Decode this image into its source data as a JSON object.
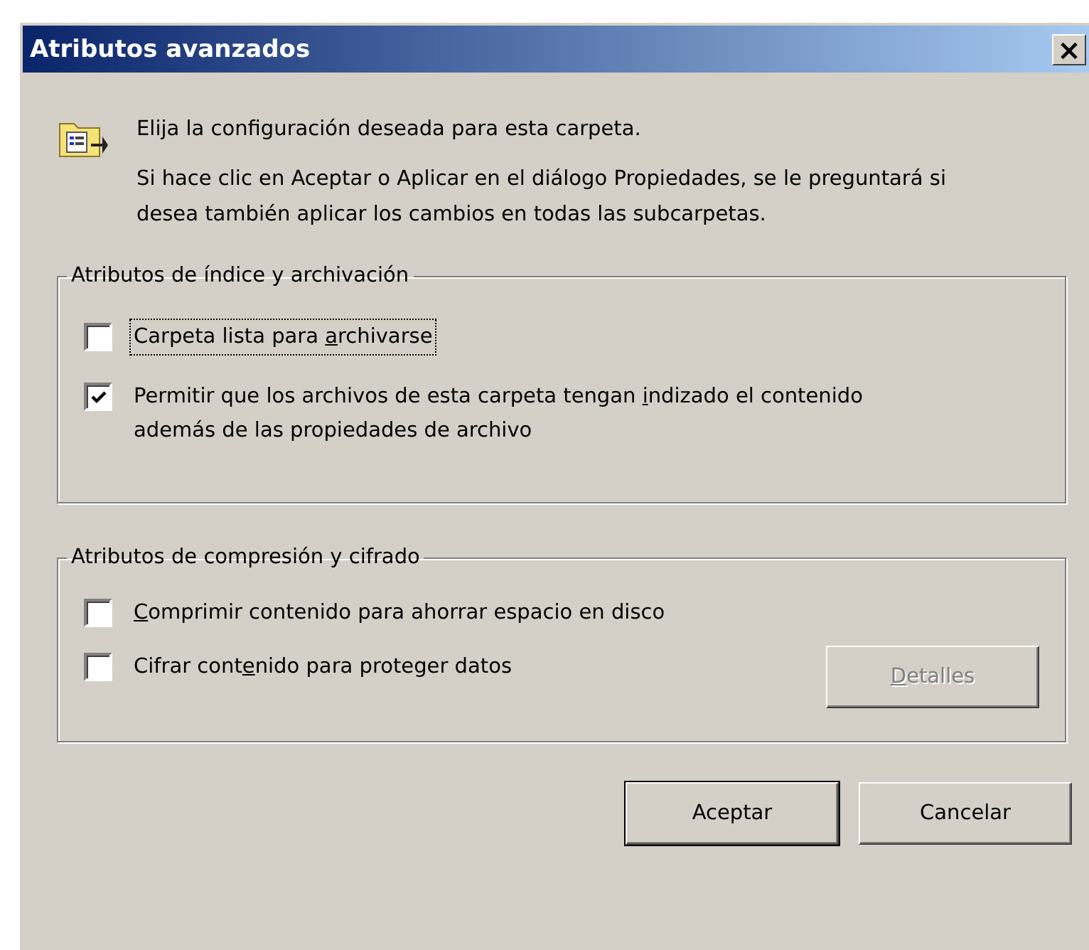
{
  "window": {
    "title": "Atributos avanzados",
    "close": "×"
  },
  "intro": [
    "Elija la configuración deseada para esta carpeta.",
    "Si hace clic en Aceptar o Aplicar en el diálogo Propiedades, se le preguntará si desea también aplicar los cambios en todas las subcarpetas."
  ],
  "groups": [
    {
      "title": "Atributos de índice y archivación",
      "options": [
        {
          "label_before": "Carpeta lista para ",
          "access_key": "a",
          "label_after": "rchivarse",
          "checked": false,
          "focused": true
        },
        {
          "label_before": "Permitir que los archivos de esta carpeta tengan ",
          "access_key": "i",
          "label_after": "ndizado el contenido además de las propiedades de archivo",
          "checked": true,
          "focused": false
        }
      ]
    },
    {
      "title": "Atributos de compresión y cifrado",
      "options": [
        {
          "access_key": "C",
          "label_after": "omprimir contenido para ahorrar espacio en disco",
          "checked": false,
          "focused": false
        },
        {
          "label_before": "Cifrar cont",
          "access_key": "e",
          "label_after": "nido para proteger datos",
          "checked": false,
          "focused": false
        }
      ],
      "button": {
        "access_key": "D",
        "label_after": "etalles",
        "disabled": true
      }
    }
  ],
  "buttons": [
    {
      "label": "Aceptar",
      "default": true
    },
    {
      "label": "Cancelar",
      "default": false
    }
  ]
}
